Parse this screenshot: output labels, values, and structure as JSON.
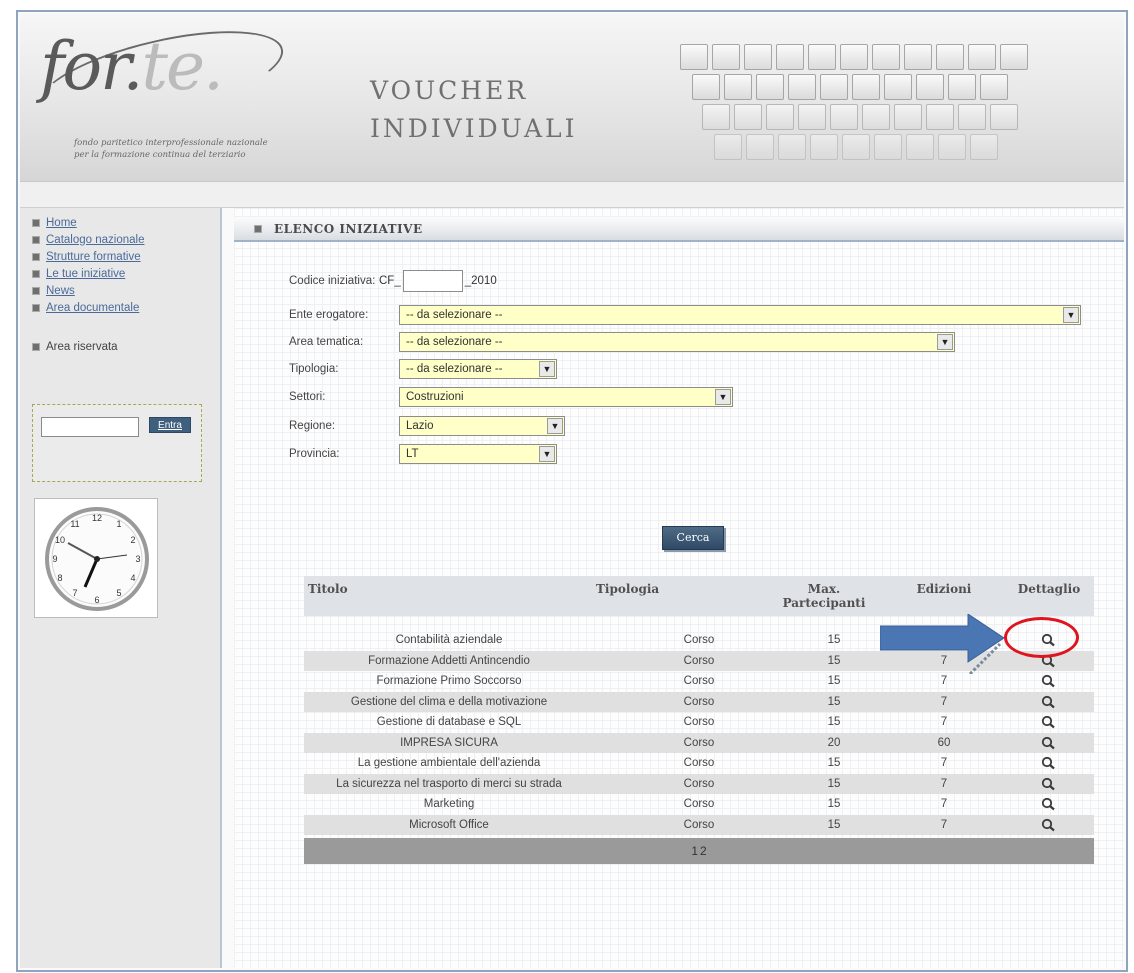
{
  "header": {
    "logo_main": "for.",
    "logo_accent": "te.",
    "logo_sub1": "fondo paritetico interprofessionale nazionale",
    "logo_sub2": "per la formazione continua del terziario",
    "title_line1": "VOUCHER",
    "title_line2": "INDIVIDUALI"
  },
  "sidebar": {
    "items": [
      {
        "label": "Home"
      },
      {
        "label": "Catalogo nazionale"
      },
      {
        "label": "Strutture formative"
      },
      {
        "label": "Le tue iniziative"
      },
      {
        "label": "News"
      },
      {
        "label": "Area documentale"
      }
    ],
    "reserved_label": "Area riservata",
    "login_button": "Entra"
  },
  "main": {
    "section_title": "ELENCO INIZIATIVE",
    "form": {
      "codice_label": "Codice iniziativa:",
      "codice_prefix": "CF_",
      "codice_value": "",
      "codice_suffix": "_2010",
      "ente_label": "Ente erogatore:",
      "ente_value": "-- da selezionare --",
      "area_label": "Area tematica:",
      "area_value": "-- da selezionare --",
      "tipologia_label": "Tipologia:",
      "tipologia_value": "-- da selezionare --",
      "settori_label": "Settori:",
      "settori_value": "Costruzioni",
      "regione_label": "Regione:",
      "regione_value": "Lazio",
      "provincia_label": "Provincia:",
      "provincia_value": "LT"
    },
    "search_button": "Cerca",
    "table": {
      "headers": {
        "titolo": "Titolo",
        "tipologia": "Tipologia",
        "max": "Max. Partecipanti",
        "edizioni": "Edizioni",
        "dettaglio": "Dettaglio"
      },
      "rows": [
        {
          "titolo": "Contabilità aziendale",
          "tipologia": "Corso",
          "max": "15",
          "edizioni": "7"
        },
        {
          "titolo": "Formazione Addetti Antincendio",
          "tipologia": "Corso",
          "max": "15",
          "edizioni": "7"
        },
        {
          "titolo": "Formazione Primo Soccorso",
          "tipologia": "Corso",
          "max": "15",
          "edizioni": "7"
        },
        {
          "titolo": "Gestione del clima e della motivazione",
          "tipologia": "Corso",
          "max": "15",
          "edizioni": "7"
        },
        {
          "titolo": "Gestione di database e SQL",
          "tipologia": "Corso",
          "max": "15",
          "edizioni": "7"
        },
        {
          "titolo": "IMPRESA SICURA",
          "tipologia": "Corso",
          "max": "20",
          "edizioni": "60"
        },
        {
          "titolo": "La gestione ambientale dell'azienda",
          "tipologia": "Corso",
          "max": "15",
          "edizioni": "7"
        },
        {
          "titolo": "La sicurezza nel trasporto di merci su strada",
          "tipologia": "Corso",
          "max": "15",
          "edizioni": "7"
        },
        {
          "titolo": "Marketing",
          "tipologia": "Corso",
          "max": "15",
          "edizioni": "7"
        },
        {
          "titolo": "Microsoft Office",
          "tipologia": "Corso",
          "max": "15",
          "edizioni": "7"
        }
      ],
      "pages": [
        "1",
        "2"
      ]
    }
  },
  "colors": {
    "select_bg": "#ffffc8",
    "button_bg": "#3f5f7f",
    "annotation_red": "#e0141e",
    "annotation_blue": "#4a77b4"
  },
  "icons": {
    "detail": "magnifier-icon",
    "bullet": "square-bullet-icon"
  }
}
